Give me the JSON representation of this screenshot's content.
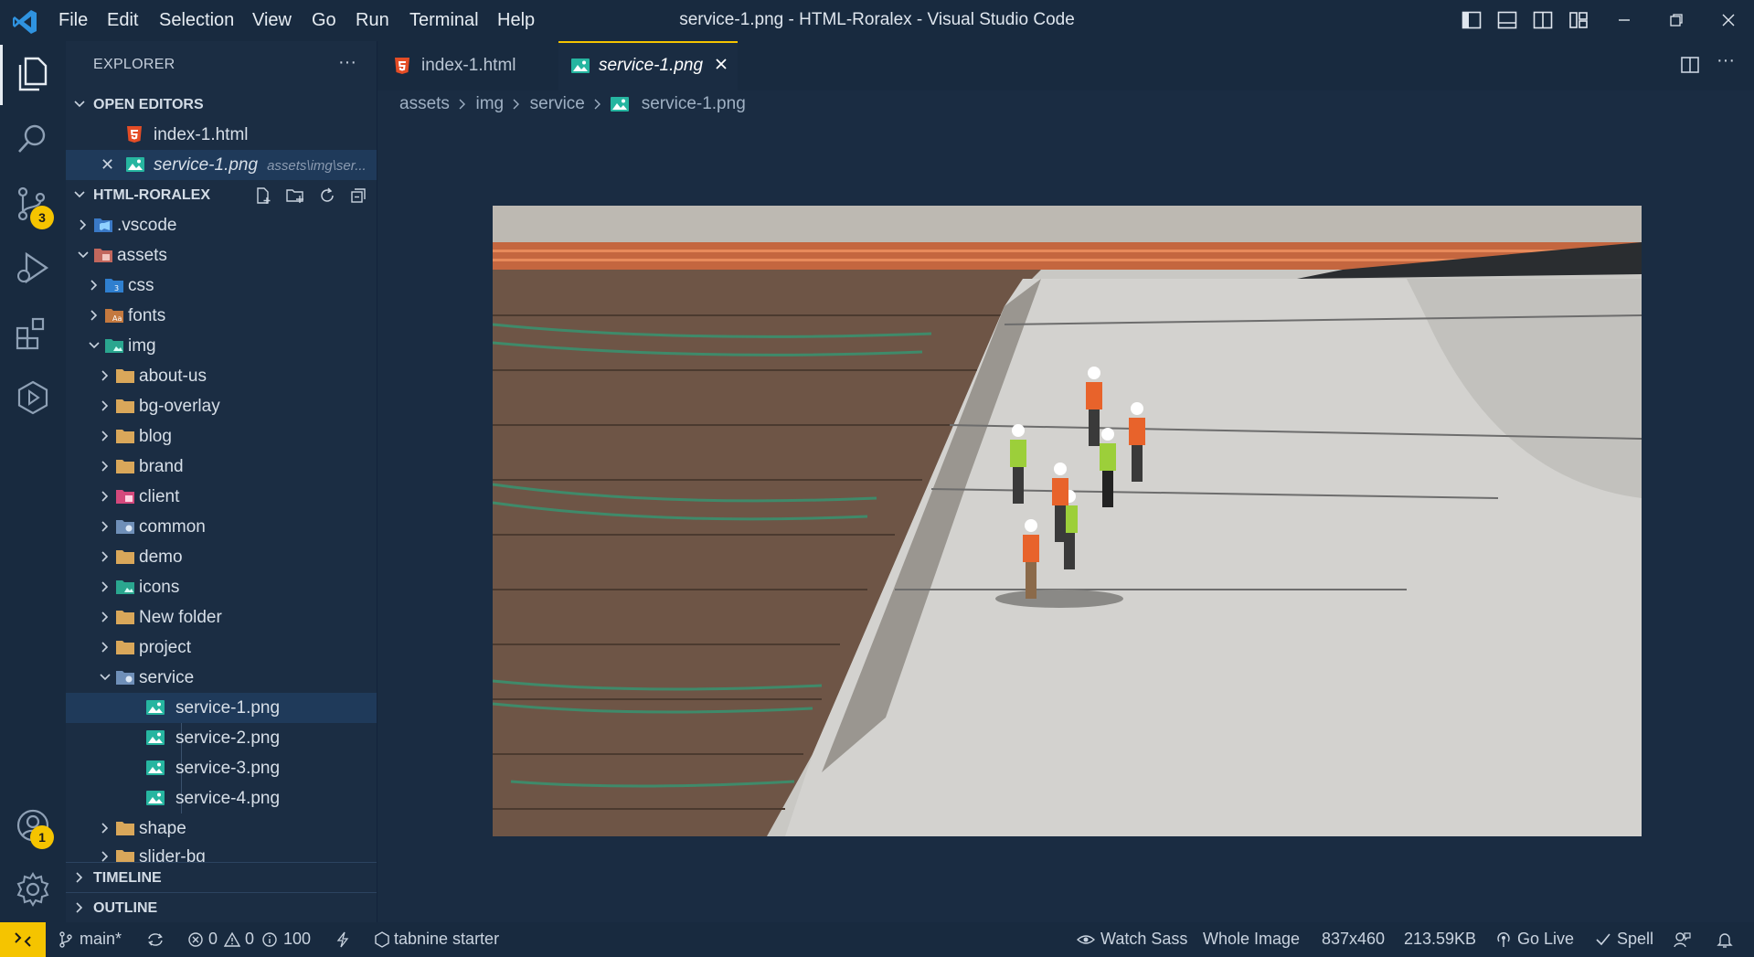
{
  "window": {
    "title": "service-1.png - HTML-Roralex - Visual Studio Code"
  },
  "menu": [
    "File",
    "Edit",
    "Selection",
    "View",
    "Go",
    "Run",
    "Terminal",
    "Help"
  ],
  "activity": {
    "source_control_badge": "3",
    "accounts_badge": "1"
  },
  "sidebar": {
    "header": "EXPLORER",
    "more": "···",
    "open_editors": {
      "title": "OPEN EDITORS",
      "items": [
        {
          "name": "index-1.html",
          "desc": ""
        },
        {
          "name": "service-1.png",
          "desc": "assets\\img\\ser..."
        }
      ]
    },
    "project": {
      "title": "HTML-RORALEX",
      "tree": [
        ".vscode",
        "assets",
        "css",
        "fonts",
        "img",
        "about-us",
        "bg-overlay",
        "blog",
        "brand",
        "client",
        "common",
        "demo",
        "icons",
        "New folder",
        "project",
        "service",
        "service-1.png",
        "service-2.png",
        "service-3.png",
        "service-4.png",
        "shape",
        "slider-bg"
      ]
    },
    "timeline": "TIMELINE",
    "outline": "OUTLINE"
  },
  "tabs": [
    {
      "label": "index-1.html"
    },
    {
      "label": "service-1.png"
    }
  ],
  "breadcrumb": [
    "assets",
    "img",
    "service",
    "service-1.png"
  ],
  "statusbar": {
    "branch": "main*",
    "errors": "0",
    "warnings": "0",
    "info": "100",
    "tabnine": "tabnine starter",
    "watch_sass": "Watch Sass",
    "zoom_mode": "Whole Image",
    "dimensions": "837x460",
    "size": "213.59KB",
    "go_live": "Go Live",
    "spell": "Spell"
  },
  "colors": {
    "accent": "#f5c400",
    "bg": "#1a2c42",
    "sidebar": "#1b2d43",
    "selection": "#1f3a5a"
  }
}
